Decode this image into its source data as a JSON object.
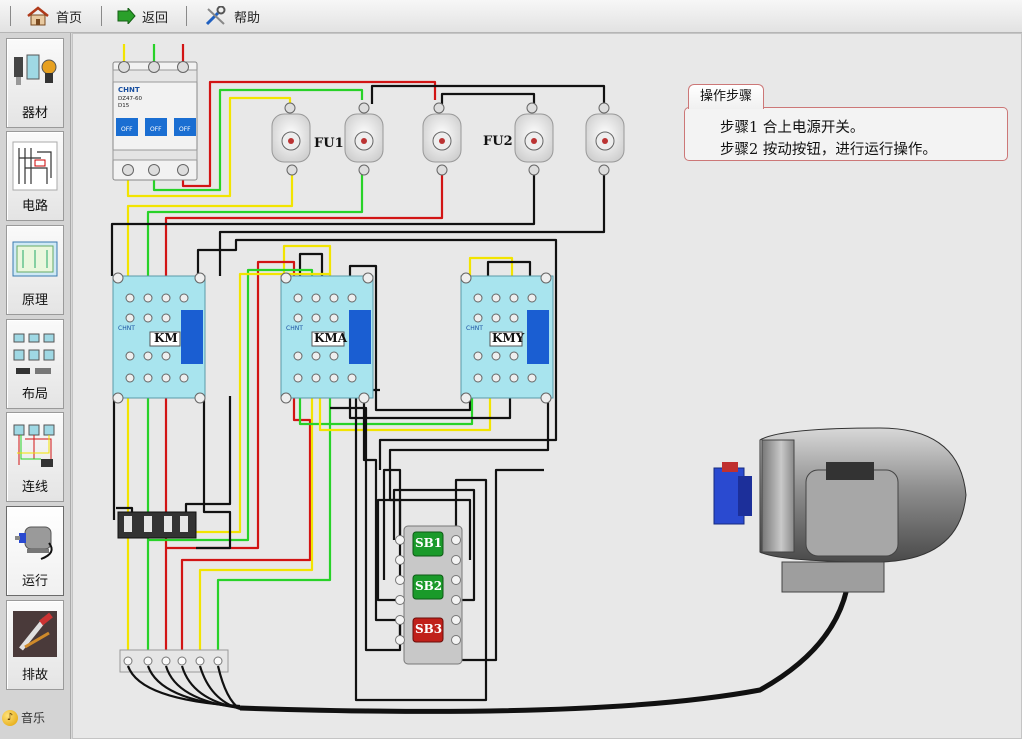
{
  "toolbar": {
    "home_label": "首页",
    "back_label": "返回",
    "help_label": "帮助"
  },
  "sidebar": {
    "items": [
      {
        "label": "器材"
      },
      {
        "label": "电路"
      },
      {
        "label": "原理"
      },
      {
        "label": "布局"
      },
      {
        "label": "连线"
      },
      {
        "label": "运行"
      },
      {
        "label": "排故"
      }
    ],
    "music_label": "音乐"
  },
  "steps": {
    "tab_label": "操作步骤",
    "lines": [
      "步骤1  合上电源开关。",
      "步骤2  按动按钮，进行运行操作。"
    ]
  },
  "labels": {
    "fu1": "FU1",
    "fu2": "FU2",
    "km": "KM",
    "kma": "KMA",
    "kmy": "KMY",
    "sb1": "SB1",
    "sb2": "SB2",
    "sb3": "SB3",
    "breaker_brand": "CHNT",
    "breaker_model": "DZ47-60",
    "breaker_rating": "D15",
    "contactor_brand": "CHNT",
    "off_label": "OFF"
  },
  "colors": {
    "wire_yellow": "#f2e400",
    "wire_green": "#28d228",
    "wire_red": "#d21414",
    "wire_black": "#111111",
    "contactor_body": "#a8e4ee",
    "sb1": "#1a9a2a",
    "sb2": "#1a9a2a",
    "sb3": "#c0201a",
    "steps_border": "#cc7777"
  }
}
